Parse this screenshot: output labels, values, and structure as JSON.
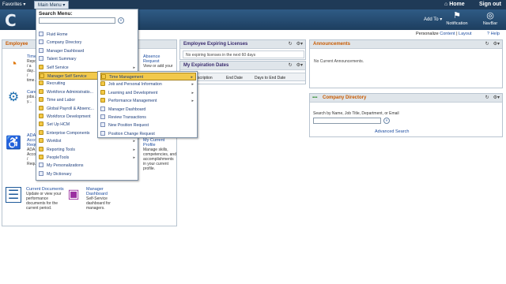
{
  "topbar": {
    "favorites": "Favorites ▾",
    "main_menu": "Main Menu ▾",
    "home": "Home",
    "sign_out": "Sign out"
  },
  "banner": {
    "brand": "C",
    "add_to": "Add To ▾",
    "notification": "Notification",
    "navbar": "NavBar"
  },
  "personalize": {
    "label": "Personalize",
    "content": "Content",
    "sep": " | ",
    "layout": "Layout",
    "help": "? Help"
  },
  "ess": {
    "title": "Employee",
    "tiles": [
      {
        "title": "Time",
        "desc": "Repo... / a day... / time..."
      },
      {
        "title": "Absence Request",
        "desc": "View or add your"
      },
      {
        "title": "Care...",
        "desc": "jobs / y..."
      },
      {
        "title": "ADA Acco... Requ...",
        "desc": "ADA / Accom... / Reque..."
      },
      {
        "title": "My Current Profile",
        "desc": "Manage skills, competencies, and accomplishments in your current profile."
      },
      {
        "title": "Current Documents",
        "desc": "Update or view your performance documents for the current period."
      },
      {
        "title": "Manager Dashboard",
        "desc": "Self-Service dashboard for managers."
      }
    ]
  },
  "licenses": {
    "title": "Employee Expiring Licenses",
    "message": "No expiring licenses in the next 60 days"
  },
  "expiration": {
    "title": "My Expiration Dates",
    "cols": [
      "scription",
      "End Date",
      "Days to End Date"
    ]
  },
  "announcements": {
    "title": "Announcements",
    "message": "No Current Announcements."
  },
  "directory": {
    "title": "Company Directory",
    "label": "Search by Name, Job Title, Department, or Email",
    "advanced": "Advanced Search"
  },
  "mainmenu": {
    "search_title": "Search Menu:",
    "items": [
      {
        "label": "Fluid Home",
        "type": "doc"
      },
      {
        "label": "Company Directory",
        "type": "doc"
      },
      {
        "label": "Manager Dashboard",
        "type": "doc"
      },
      {
        "label": "Talent Summary",
        "type": "doc"
      },
      {
        "label": "Self Service",
        "type": "folder"
      },
      {
        "label": "Manager Self Service",
        "type": "folder"
      },
      {
        "label": "Recruiting",
        "type": "folder"
      },
      {
        "label": "Workforce Administratio...",
        "type": "folder"
      },
      {
        "label": "Time and Labor",
        "type": "folder"
      },
      {
        "label": "Global Payroll & Absenc...",
        "type": "folder"
      },
      {
        "label": "Workforce Development",
        "type": "folder"
      },
      {
        "label": "Set Up HCM",
        "type": "folder"
      },
      {
        "label": "Enterprise Components",
        "type": "folder"
      },
      {
        "label": "Worklist",
        "type": "folder"
      },
      {
        "label": "Reporting Tools",
        "type": "folder"
      },
      {
        "label": "PeopleTools",
        "type": "folder"
      },
      {
        "label": "My Personalizations",
        "type": "doc"
      },
      {
        "label": "My Dictionary",
        "type": "doc"
      }
    ]
  },
  "submenu": {
    "items": [
      {
        "label": "Time Management",
        "type": "folder"
      },
      {
        "label": "Job and Personal Information",
        "type": "folder"
      },
      {
        "label": "Learning and Development",
        "type": "folder"
      },
      {
        "label": "Performance Management",
        "type": "folder"
      },
      {
        "label": "Manager Dashboard",
        "type": "doc"
      },
      {
        "label": "Review Transactions",
        "type": "doc"
      },
      {
        "label": "New Position Request",
        "type": "doc"
      },
      {
        "label": "Position Change Request",
        "type": "doc"
      }
    ]
  },
  "colors": {
    "header": "#1f3a57",
    "highlight": "#f2c94c",
    "link": "#1e4ea1"
  }
}
